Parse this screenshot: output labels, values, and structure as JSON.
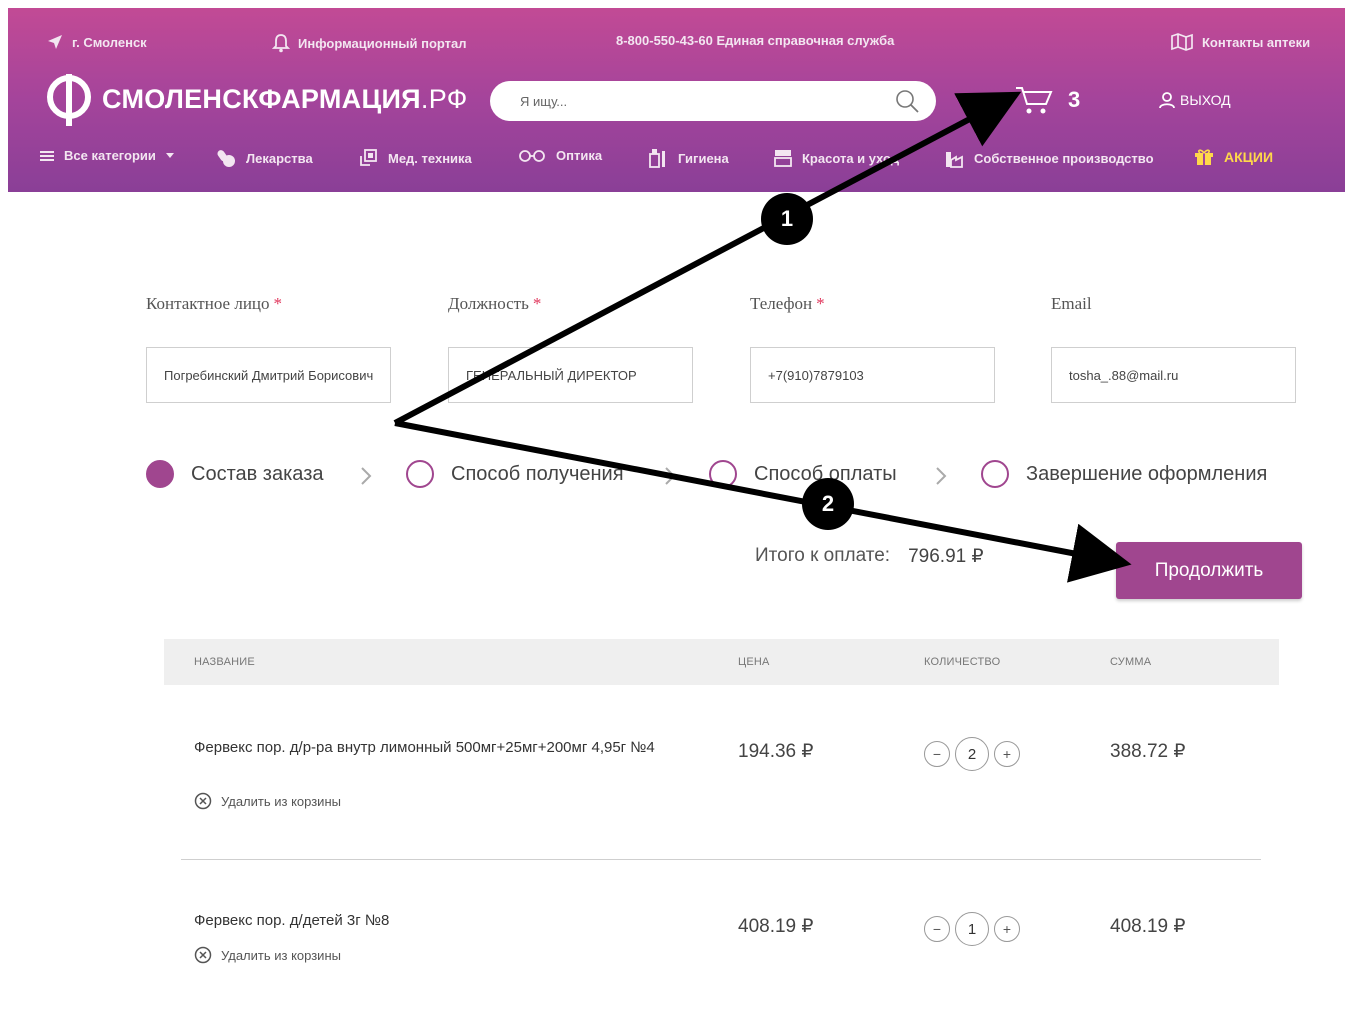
{
  "topbar": {
    "city": "г. Смоленск",
    "info_portal": "Информационный портал",
    "phone": "8-800-550-43-60 Единая справочная служба",
    "contacts": "Контакты аптеки"
  },
  "logo": {
    "name": "СМОЛЕНСКФАРМАЦИЯ",
    "domain": ".РФ"
  },
  "search": {
    "placeholder": "Я ищу..."
  },
  "cart": {
    "count": "3"
  },
  "login": {
    "label": "ВЫХОД"
  },
  "nav": {
    "all_categories": "Все категории",
    "medicines": "Лекарства",
    "med_tech": "Мед. техника",
    "optics": "Оптика",
    "hygiene": "Гигиена",
    "beauty": "Красота и уход",
    "own_production": "Собственное производство",
    "promo": "АКЦИИ"
  },
  "form": {
    "contact_label": "Контактное лицо",
    "contact_value": "Погребинский Дмитрий Борисович",
    "position_label": "Должность",
    "position_value": "ГЕНЕРАЛЬНЫЙ ДИРЕКТОР",
    "phone_label": "Телефон",
    "phone_value": "+7(910)7879103",
    "email_label": "Email",
    "email_value": "tosha_.88@mail.ru",
    "required_mark": "*"
  },
  "steps": {
    "step1": "Состав заказа",
    "step2": "Способ получения",
    "step3": "Способ оплаты",
    "step4": "Завершение оформления"
  },
  "total": {
    "label": "Итого к оплате:",
    "value": "796.91 ₽"
  },
  "continue_label": "Продолжить",
  "table": {
    "headers": {
      "name": "НАЗВАНИЕ",
      "price": "ЦЕНА",
      "qty": "КОЛИЧЕСТВО",
      "sum": "СУММА"
    },
    "remove_label": "Удалить из корзины",
    "rows": [
      {
        "name": "Фервекс пор. д/р-ра внутр лимонный 500мг+25мг+200мг 4,95г №4",
        "price": "194.36 ₽",
        "qty": "2",
        "sum": "388.72 ₽"
      },
      {
        "name": "Фервекс пор. д/детей 3г №8",
        "price": "408.19 ₽",
        "qty": "1",
        "sum": "408.19 ₽"
      }
    ]
  },
  "annotations": {
    "badge1": "1",
    "badge2": "2"
  },
  "colors": {
    "brand": "#a0468f",
    "header_top": "#c24a95",
    "header_bottom": "#8a3f97",
    "promo": "#ffd84a",
    "required": "#e0345a"
  }
}
